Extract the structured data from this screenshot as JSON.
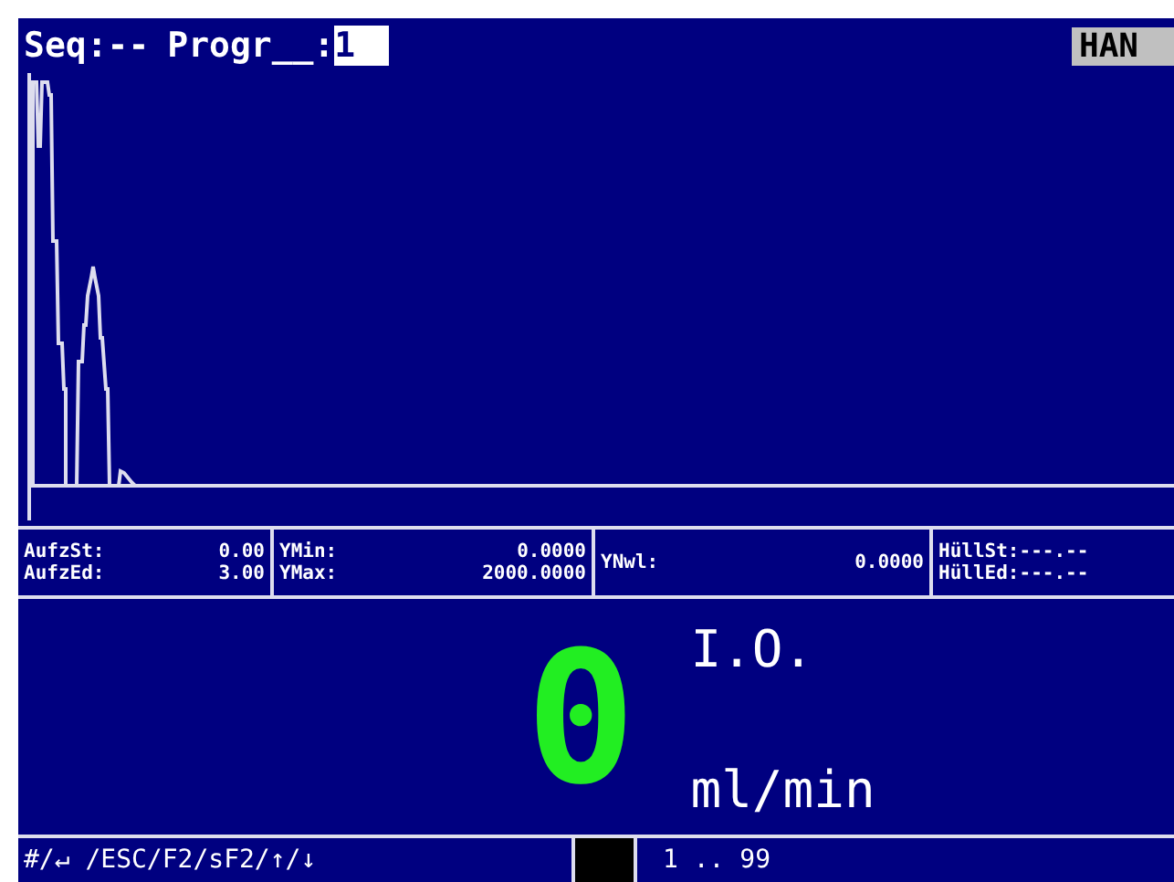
{
  "header": {
    "sequence": "Seq:--",
    "program_label": "Progr__:",
    "program_value": "1",
    "mode": "HAN"
  },
  "info": [
    {
      "label": "AufzSt:",
      "value": "0.00"
    },
    {
      "label": "AufzEd:",
      "value": "3.00"
    },
    {
      "label": "YMin:",
      "value": "0.0000"
    },
    {
      "label": "YMax:",
      "value": "2000.0000"
    },
    {
      "label": "YNwl:",
      "value": "0.0000"
    },
    {
      "label": "HüllSt:",
      "value": "---.--"
    },
    {
      "label": "HüllEd:",
      "value": "---.--"
    }
  ],
  "display": {
    "value": "0",
    "status": "I.O.",
    "unit": "ml/min"
  },
  "footer": {
    "keys": "#/↵ /ESC/F2/sF2/↑/↓",
    "range": "1 .. 99"
  }
}
